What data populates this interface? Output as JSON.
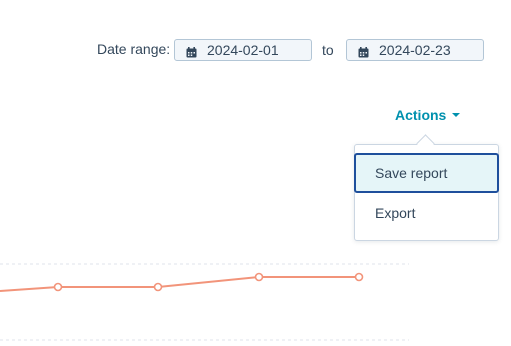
{
  "filters": {
    "date_range_label": "Date range:",
    "start_date": "2024-02-01",
    "to_label": "to",
    "end_date": "2024-02-23",
    "calendar_icon": "calendar-icon"
  },
  "actions": {
    "label": "Actions",
    "caret_icon": "caret-down-icon",
    "menu_items": [
      {
        "label": "Save report",
        "state": "focused"
      },
      {
        "label": "Export",
        "state": "default"
      }
    ]
  },
  "colors": {
    "accent": "#0091ae",
    "text": "#33475b",
    "series_line": "#f2947a",
    "focus_border": "#1e4f9c",
    "focus_bg": "#e5f5f8"
  }
}
